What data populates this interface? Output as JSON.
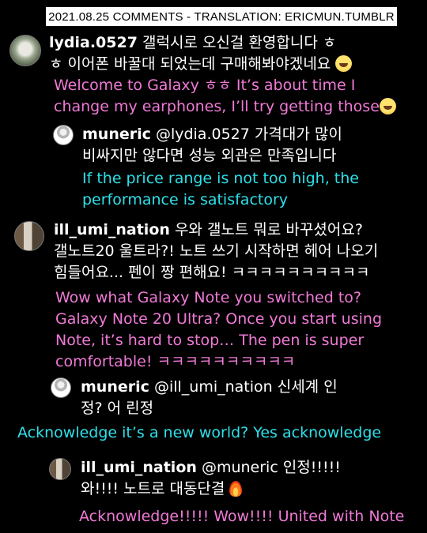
{
  "header": {
    "banner": "2021.08.25 COMMENTS - TRANSLATION: ERICMUN.TUMBLR"
  },
  "thread": [
    {
      "user": "lydia.0527",
      "line1_korean": "갤럭시로 오신걸 환영합니다 ㅎ",
      "line2_korean": "ㅎ 이어폰 바꿀대 되었는데 구매해봐야겠네요",
      "translation_line1": "Welcome to Galaxy ㅎㅎ It’s about time I",
      "translation_line2": "change my earphones, I’ll try getting those",
      "emoji": "grinning-squinting-face",
      "translation_color": "#f07ad6"
    },
    {
      "user": "muneric",
      "line1_korean": "@lydia.0527 가격대가 많이",
      "line2_korean": "비싸지만 않다면 성능 외관은 만족입니다",
      "translation_line1": "If the price range is not too high, the",
      "translation_line2": "performance is satisfactory",
      "translation_color": "#2ee0ea"
    },
    {
      "user": "ill_umi_nation",
      "line1_korean": "우와 갤노트 뭐로 바꾸셨어요?",
      "line2_korean": "갤노트20 울트라?! 노트 쓰기 시작하면 헤어 나오기",
      "line3_korean": "힘들어요... 펜이 짱 편해요! ㅋㅋㅋㅋㅋㅋㅋㅋㅋㅋ",
      "translation_line1": "Wow what Galaxy Note you switched to?",
      "translation_line2": "Galaxy Note 20 Ultra? Once you start using",
      "translation_line3": "Note, it’s hard to stop… The pen is super",
      "translation_line4": "comfortable! ㅋㅋㅋㅋㅋㅋㅋㅋㅋㅋ",
      "translation_color": "#f07ad6"
    },
    {
      "user": "muneric",
      "line1_korean": "@ill_umi_nation 신세계 인",
      "line2_korean": "정? 어 린정",
      "translation_line1": "Acknowledge it’s a new world? Yes acknowledge",
      "translation_color": "#2ee0ea"
    },
    {
      "user": "ill_umi_nation",
      "line1_korean": "@muneric 인정!!!!!",
      "line2_korean": "와!!!! 노트로 대동단결",
      "emoji": "fire",
      "translation_line1": "Acknowledge!!!!! Wow!!!! United with Note",
      "translation_color": "#f07ad6"
    }
  ]
}
